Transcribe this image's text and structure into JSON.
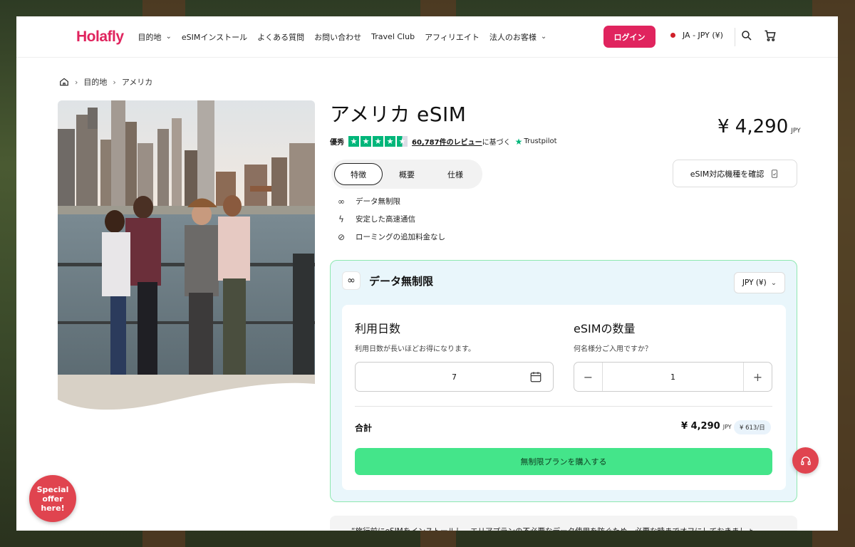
{
  "header": {
    "logo": "Holafly",
    "nav": [
      {
        "label": "目的地",
        "dropdown": true
      },
      {
        "label": "eSIMインストール",
        "dropdown": false
      },
      {
        "label": "よくある質問",
        "dropdown": false
      },
      {
        "label": "お問い合わせ",
        "dropdown": false
      },
      {
        "label": "Travel Club",
        "dropdown": false
      },
      {
        "label": "アフィリエイト",
        "dropdown": false
      },
      {
        "label": "法人のお客様",
        "dropdown": true
      }
    ],
    "login_label": "ログイン",
    "lang_label": "JA - JPY (¥)"
  },
  "breadcrumb": [
    "目的地",
    "アメリカ"
  ],
  "product": {
    "title": "アメリカ eSIM",
    "rating_label": "優秀",
    "rating_stars": 4.5,
    "reviews_link": "60,787件のレビュー",
    "reviews_suffix": "に基づく",
    "trustpilot": "Trustpilot",
    "price": "¥ 4,290",
    "price_currency": "JPY",
    "tabs": [
      "特徴",
      "概要",
      "仕様"
    ],
    "active_tab": 0,
    "compat_button": "eSIM対応機種を確認",
    "features": [
      {
        "icon": "infinity-icon",
        "label": "データ無制限"
      },
      {
        "icon": "bolt-icon",
        "label": "安定した高速通信"
      },
      {
        "icon": "no-roaming-icon",
        "label": "ローミングの追加料金なし"
      }
    ]
  },
  "plan": {
    "title": "データ無制限",
    "currency_select": "JPY (¥)",
    "days_label": "利用日数",
    "days_sub": "利用日数が長いほどお得になります。",
    "days_value": "7",
    "qty_label": "eSIMの数量",
    "qty_sub": "何名様分ご入用ですか？",
    "qty_value": "1",
    "total_label": "合計",
    "total_price": "¥ 4,290",
    "total_currency": "JPY",
    "per_day": "¥ 613/日",
    "buy_label": "無制限プランを購入する"
  },
  "note": "“旅行前にeSIMをインストールし、エリアプランの不必要なデータ使用を防ぐため、必要な時までオフにしておきましょ",
  "special_offer": "Special offer here!",
  "colors": {
    "brand": "#e0245e",
    "buy": "#44e58a",
    "trustpilot": "#00b67a"
  }
}
